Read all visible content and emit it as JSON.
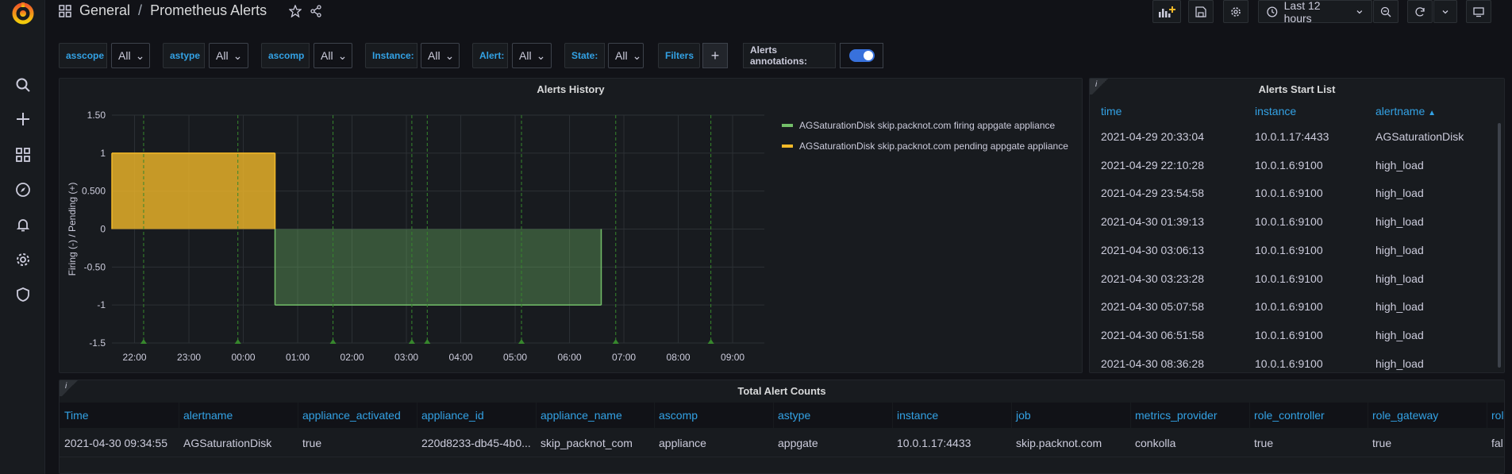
{
  "breadcrumb": {
    "folder": "General",
    "separator": "/",
    "dashboard": "Prometheus Alerts"
  },
  "toolbar": {
    "time_range": "Last 12 hours"
  },
  "variables": [
    {
      "label": "asscope",
      "value": "All"
    },
    {
      "label": "astype",
      "value": "All"
    },
    {
      "label": "ascomp",
      "value": "All"
    },
    {
      "label": "Instance:",
      "value": "All"
    },
    {
      "label": "Alert:",
      "value": "All"
    },
    {
      "label": "State:",
      "value": "All"
    }
  ],
  "filters_label": "Filters",
  "annotations_label": "Alerts annotations:",
  "history_panel": {
    "title": "Alerts History",
    "legend": [
      {
        "name": "AGSaturationDisk skip.packnot.com firing appgate appliance",
        "color": "#73bf69"
      },
      {
        "name": "AGSaturationDisk skip.packnot.com pending appgate appliance",
        "color": "#f2b929"
      }
    ]
  },
  "chart_data": {
    "type": "area",
    "title": "Alerts History",
    "ylabel": "Firing (-) / Pending (+)",
    "xlabel": "",
    "ylim": [
      -1.5,
      1.5
    ],
    "y_ticks": [
      "1.50",
      "1",
      "0.500",
      "0",
      "-0.50",
      "-1",
      "-1.5"
    ],
    "y_tick_values": [
      1.5,
      1,
      0.5,
      0,
      -0.5,
      -1,
      -1.5
    ],
    "x_ticks": [
      "22:00",
      "23:00",
      "00:00",
      "01:00",
      "02:00",
      "03:00",
      "04:00",
      "05:00",
      "06:00",
      "07:00",
      "08:00",
      "09:00"
    ],
    "x_start": "21:35",
    "x_end": "09:35",
    "series": [
      {
        "name": "AGSaturationDisk skip.packnot.com pending appgate appliance",
        "color": "#f2b929",
        "from": "21:35",
        "to": "00:35",
        "value": 1
      },
      {
        "name": "AGSaturationDisk skip.packnot.com firing appgate appliance",
        "color": "#73bf69",
        "from": "00:35",
        "to": "06:35",
        "value": -1
      }
    ],
    "annotations": [
      "22:10",
      "23:54",
      "01:39",
      "03:06",
      "03:23",
      "05:07",
      "06:51",
      "08:36"
    ],
    "grid": true
  },
  "start_list_panel": {
    "title": "Alerts Start List",
    "columns": [
      "time",
      "instance",
      "alertname"
    ],
    "rows": [
      [
        "2021-04-29 20:33:04",
        "10.0.1.17:4433",
        "AGSaturationDisk"
      ],
      [
        "2021-04-29 22:10:28",
        "10.0.1.6:9100",
        "high_load"
      ],
      [
        "2021-04-29 23:54:58",
        "10.0.1.6:9100",
        "high_load"
      ],
      [
        "2021-04-30 01:39:13",
        "10.0.1.6:9100",
        "high_load"
      ],
      [
        "2021-04-30 03:06:13",
        "10.0.1.6:9100",
        "high_load"
      ],
      [
        "2021-04-30 03:23:28",
        "10.0.1.6:9100",
        "high_load"
      ],
      [
        "2021-04-30 05:07:58",
        "10.0.1.6:9100",
        "high_load"
      ],
      [
        "2021-04-30 06:51:58",
        "10.0.1.6:9100",
        "high_load"
      ],
      [
        "2021-04-30 08:36:28",
        "10.0.1.6:9100",
        "high_load"
      ]
    ]
  },
  "counts_panel": {
    "title": "Total Alert Counts",
    "columns": [
      "Time",
      "alertname",
      "appliance_activated",
      "appliance_id",
      "appliance_name",
      "ascomp",
      "astype",
      "instance",
      "job",
      "metrics_provider",
      "role_controller",
      "role_gateway",
      "rol"
    ],
    "rows": [
      [
        "2021-04-30 09:34:55",
        "AGSaturationDisk",
        "true",
        "220d8233-db45-4b0...",
        "skip_packnot_com",
        "appliance",
        "appgate",
        "10.0.1.17:4433",
        "skip.packnot.com",
        "conkolla",
        "true",
        "true",
        "fal"
      ]
    ]
  }
}
